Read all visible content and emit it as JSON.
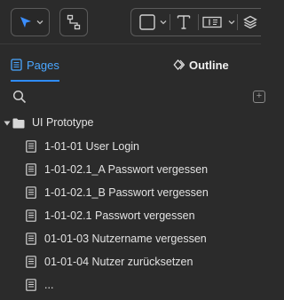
{
  "toolbar": {
    "tools": [
      {
        "name": "select-tool",
        "icon": "arrow-pointer-icon",
        "active": true
      },
      {
        "name": "connector-tool",
        "icon": "connector-icon"
      },
      {
        "name": "rectangle-tool",
        "icon": "rectangle-icon"
      },
      {
        "name": "text-tool",
        "icon": "text-icon",
        "glyph": "T"
      },
      {
        "name": "component-tool",
        "icon": "component-icon"
      },
      {
        "name": "layers-tool",
        "icon": "layers-icon"
      }
    ]
  },
  "tabs": {
    "pages_label": "Pages",
    "outline_label": "Outline",
    "active": "Pages"
  },
  "search": {
    "placeholder": "",
    "add_icon": "+"
  },
  "tree": {
    "folder": {
      "label": "UI Prototype",
      "expanded": true
    },
    "pages": [
      {
        "label": "1-01-01 User Login"
      },
      {
        "label": "1-01-02.1_A Passwort vergessen"
      },
      {
        "label": "1-01-02.1_B Passwort vergessen"
      },
      {
        "label": "1-01-02.1 Passwort vergessen"
      },
      {
        "label": "01-01-03 Nutzername vergessen"
      },
      {
        "label": "01-01-04 Nutzer zurücksetzen"
      },
      {
        "label": "..."
      }
    ]
  },
  "colors": {
    "background": "#2b2b2b",
    "accent": "#2f8cff",
    "text": "#e2e2e2"
  }
}
